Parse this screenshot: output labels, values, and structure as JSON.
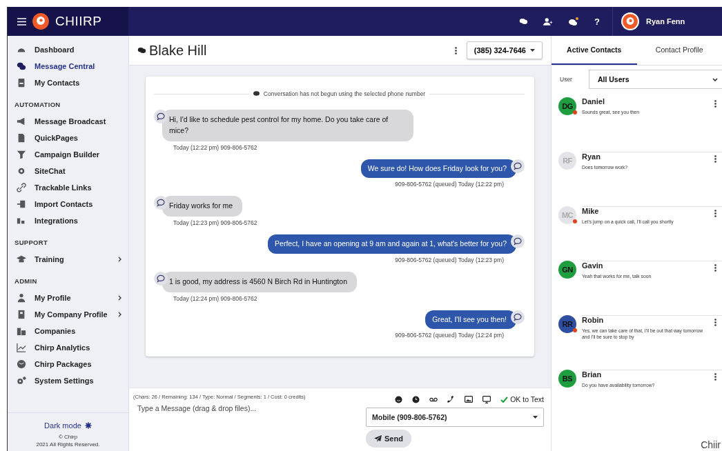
{
  "header": {
    "brand": "CHIIRP",
    "help": "?",
    "user_name": "Ryan Fenn"
  },
  "sidebar": {
    "sections": [
      {
        "items": [
          {
            "label": "Dashboard",
            "selected": false,
            "submenu": false
          },
          {
            "label": "Message Central",
            "selected": true,
            "submenu": false
          },
          {
            "label": "My Contacts",
            "selected": false,
            "submenu": false
          }
        ]
      },
      {
        "heading": "AUTOMATION",
        "items": [
          {
            "label": "Message Broadcast",
            "selected": false,
            "submenu": false
          },
          {
            "label": "QuickPages",
            "selected": false,
            "submenu": false
          },
          {
            "label": "Campaign Builder",
            "selected": false,
            "submenu": false
          },
          {
            "label": "SiteChat",
            "selected": false,
            "submenu": false
          },
          {
            "label": "Trackable Links",
            "selected": false,
            "submenu": false
          },
          {
            "label": "Import Contacts",
            "selected": false,
            "submenu": false
          },
          {
            "label": "Integrations",
            "selected": false,
            "submenu": false
          }
        ]
      },
      {
        "heading": "SUPPORT",
        "items": [
          {
            "label": "Training",
            "selected": false,
            "submenu": true
          }
        ]
      },
      {
        "heading": "ADMIN",
        "items": [
          {
            "label": "My Profile",
            "selected": false,
            "submenu": true
          },
          {
            "label": "My Company Profile",
            "selected": false,
            "submenu": true
          },
          {
            "label": "Companies",
            "selected": false,
            "submenu": false
          },
          {
            "label": "Chirp Analytics",
            "selected": false,
            "submenu": false
          },
          {
            "label": "Chirp Packages",
            "selected": false,
            "submenu": false
          },
          {
            "label": "System Settings",
            "selected": false,
            "submenu": false
          }
        ]
      }
    ],
    "dark_mode": "Dark mode",
    "copyright": "© Chirp",
    "rights": "2021 All Rights Reserved."
  },
  "conversation": {
    "title": "Blake Hill",
    "phone": "(385) 324-7646",
    "notice": "Conversation has not begun using the selected phone number",
    "messages": [
      {
        "kind": "incoming",
        "text": "Hi, I'd like to schedule pest control for my home. Do you take care of mice?",
        "meta": "Today (12:22 pm) 909-806-5762"
      },
      {
        "kind": "outgoing",
        "text": "We sure do! How does Friday look for you?",
        "meta": "909-806-5762 (queued) Today (12:22 pm)"
      },
      {
        "kind": "incoming",
        "text": "Friday works for me",
        "meta": "Today (12:23 pm) 909-806-5762"
      },
      {
        "kind": "outgoing",
        "text": "Perfect, I have an opening at 9 am and again at 1, what's better for you?",
        "meta": "909-806-5762 (queued) Today (12:23 pm)"
      },
      {
        "kind": "incoming",
        "text": "1 is good, my address is 4560 N Birch Rd in Huntington",
        "meta": "Today (12:24 pm) 909-806-5762"
      },
      {
        "kind": "outgoing",
        "text": "Great, I'll see you then!",
        "meta": "909-806-5762 (queued) Today (12:24 pm)"
      }
    ]
  },
  "composer": {
    "stats": "(Chars: 26 / Remaining: 134 / Type: Normal / Segments: 1 / Cost: 0 credits)",
    "placeholder": "Type a Message (drag & drop files)...",
    "ok_to_text": "OK to Text",
    "number": "Mobile (909-806-5762)",
    "send": "Send"
  },
  "contacts_panel": {
    "tabs": [
      {
        "label": "Active Contacts",
        "selected": true
      },
      {
        "label": "Contact Profile",
        "selected": false
      }
    ],
    "user_label": "User",
    "user_filter": "All Users",
    "contacts": [
      {
        "initials": "DG",
        "name": "Daniel",
        "preview": "Sounds great, see you then",
        "color": "#1e9e3e",
        "unread": true
      },
      {
        "initials": "RF",
        "name": "Ryan",
        "preview": "Does tomorrow work?",
        "color": "#e4e4e8",
        "unread": false
      },
      {
        "initials": "MC",
        "name": "Mike",
        "preview": "Let's jump on a quick call, I'll call you shortly",
        "color": "#e4e4e8",
        "unread": true
      },
      {
        "initials": "GN",
        "name": "Gavin",
        "preview": "Yeah that works for me, talk soon",
        "color": "#1e9e3e",
        "unread": false
      },
      {
        "initials": "RR",
        "name": "Robin",
        "preview": "Yes, we can take care of that, I'll be out that way tomorrow and I'll be sure to stop by",
        "color": "#2e4fa0",
        "unread": true
      },
      {
        "initials": "BS",
        "name": "Brian",
        "preview": "Do you have availability tomorrow?",
        "color": "#1e9e3e",
        "unread": false
      }
    ]
  },
  "caption": "Chiir"
}
